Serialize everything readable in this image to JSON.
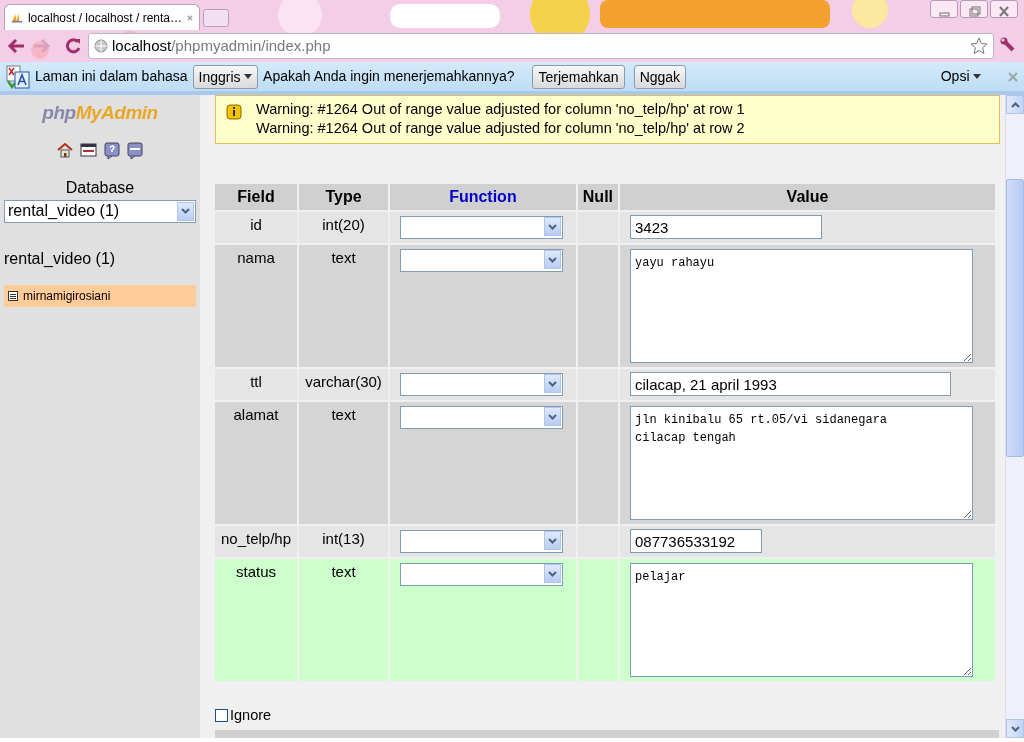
{
  "browser": {
    "tab": {
      "title": "localhost / localhost / renta…",
      "selected": true
    },
    "address": {
      "host": "localhost",
      "path": "/phpmyadmin/index.php"
    }
  },
  "translate_bar": {
    "prefix": "Laman ini dalam bahasa",
    "language": "Inggris",
    "question": "Apakah Anda ingin menerjemahkannya?",
    "buttons": [
      "Terjemahkan",
      "Nggak"
    ],
    "options": "Opsi"
  },
  "sidebar": {
    "logo": [
      "php",
      "MyAdmin"
    ],
    "database_label": "Database",
    "database_select": "rental_video (1)",
    "database_title": "rental_video (1)",
    "tables": [
      {
        "name": "mirnamigirosiani",
        "selected": true
      }
    ]
  },
  "warnings": [
    "Warning: #1264 Out of range value adjusted for column 'no_telp/hp' at row 1",
    "Warning: #1264 Out of range value adjusted for column 'no_telp/hp' at row 2"
  ],
  "table": {
    "columns": [
      "Field",
      "Type",
      "Function",
      "Null",
      "Value"
    ],
    "rows": [
      {
        "field": "id",
        "type": "int(20)",
        "kind": "input",
        "value": "3423",
        "marked": false
      },
      {
        "field": "nama",
        "type": "text",
        "kind": "textarea",
        "value": "yayu rahayu",
        "marked": false
      },
      {
        "field": "ttl",
        "type": "varchar(30)",
        "kind": "input",
        "value": "cilacap, 21 april 1993",
        "marked": false
      },
      {
        "field": "alamat",
        "type": "text",
        "kind": "textarea",
        "value": "jln kinibalu 65 rt.05/vi sidanegara\ncilacap tengah",
        "marked": false
      },
      {
        "field": "no_telp/hp",
        "type": "int(13)",
        "kind": "input",
        "value": "087736533192",
        "marked": false
      },
      {
        "field": "status",
        "type": "text",
        "kind": "textarea",
        "value": "pelajar",
        "marked": true
      }
    ]
  },
  "ignore": {
    "label": "Ignore",
    "checked": false
  }
}
